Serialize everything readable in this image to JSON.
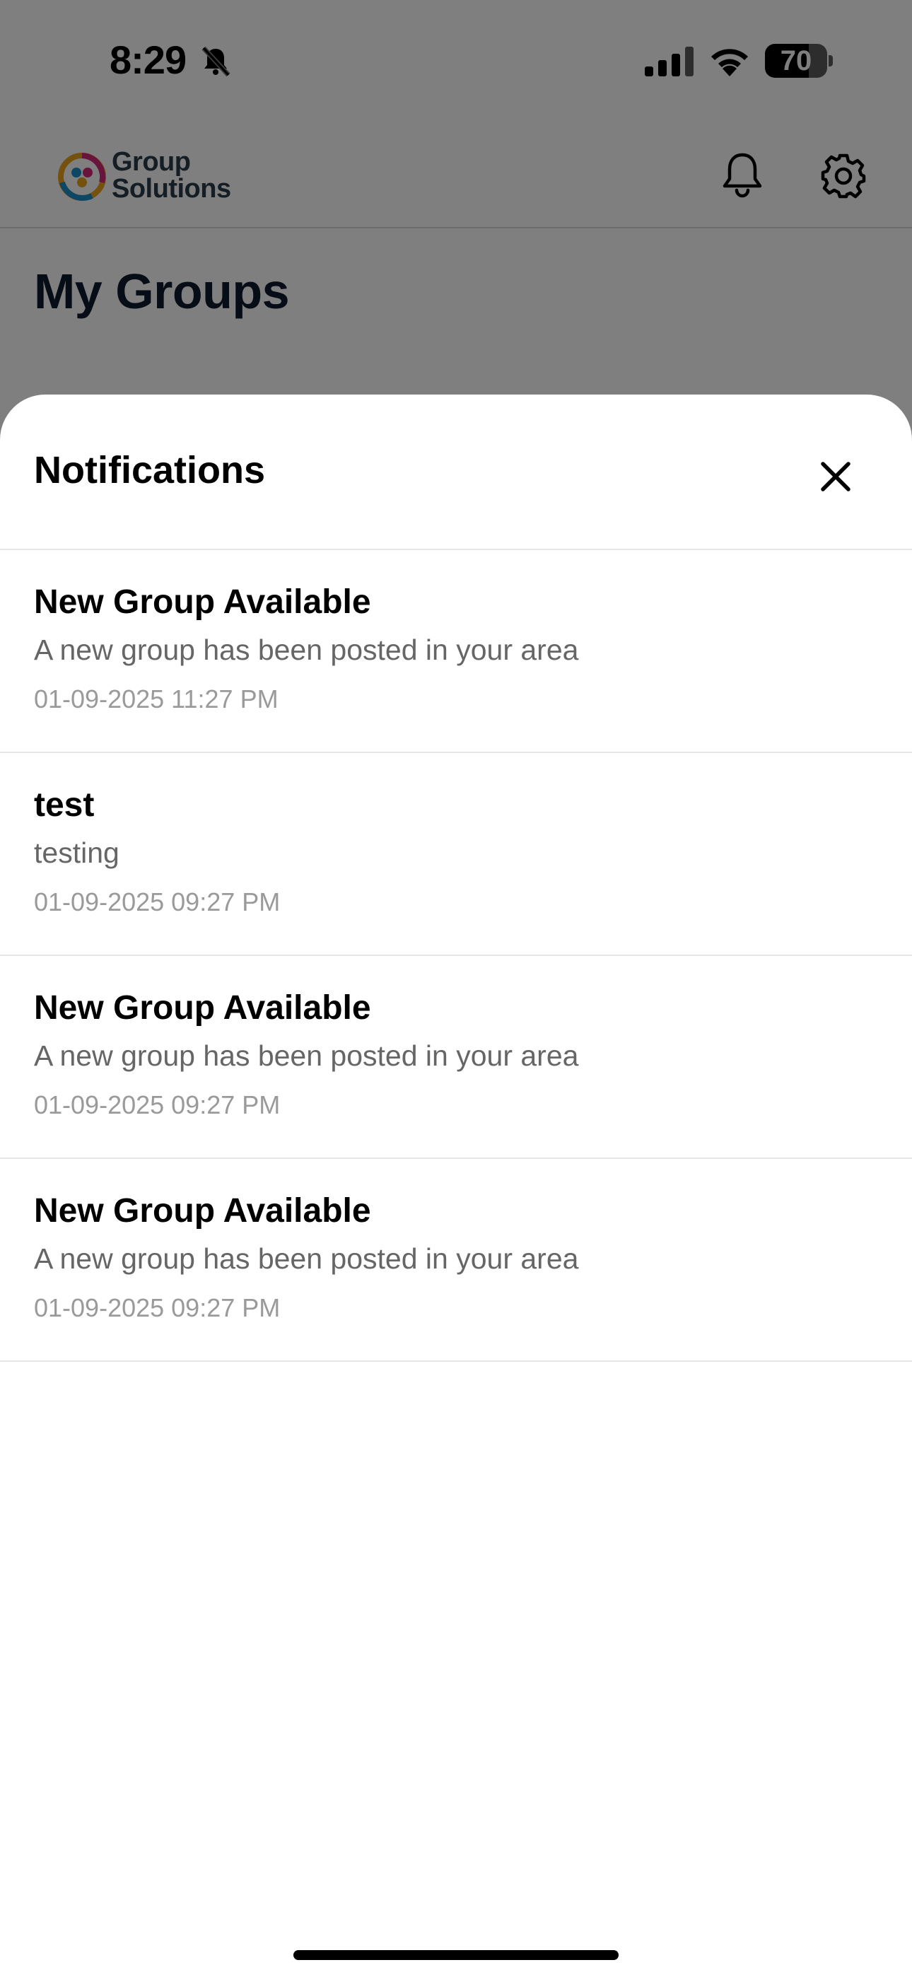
{
  "status_bar": {
    "time": "8:29",
    "battery_percent": "70",
    "battery_level": 0.7
  },
  "app": {
    "logo_line1": "Group",
    "logo_line2": "Solutions",
    "page_title": "My Groups",
    "icons": {
      "bell": "bell-icon",
      "settings": "gear-icon",
      "silent": "bell-slash-icon",
      "signal": "cellular-signal-icon",
      "wifi": "wifi-icon"
    }
  },
  "sheet": {
    "title": "Notifications",
    "close_icon": "close-icon"
  },
  "notifications": [
    {
      "title": "New Group Available",
      "body": "A new group has been posted in your area",
      "time": "01-09-2025 11:27 PM"
    },
    {
      "title": "test",
      "body": "testing",
      "time": "01-09-2025 09:27 PM"
    },
    {
      "title": "New Group Available",
      "body": "A new group has been posted in your area",
      "time": "01-09-2025 09:27 PM"
    },
    {
      "title": "New Group Available",
      "body": "A new group has been posted in your area",
      "time": "01-09-2025 09:27 PM"
    }
  ],
  "colors": {
    "overlay": "#7a7a7a",
    "title_text": "#000000",
    "body_text": "#666666",
    "time_text": "#9a9a9a"
  }
}
